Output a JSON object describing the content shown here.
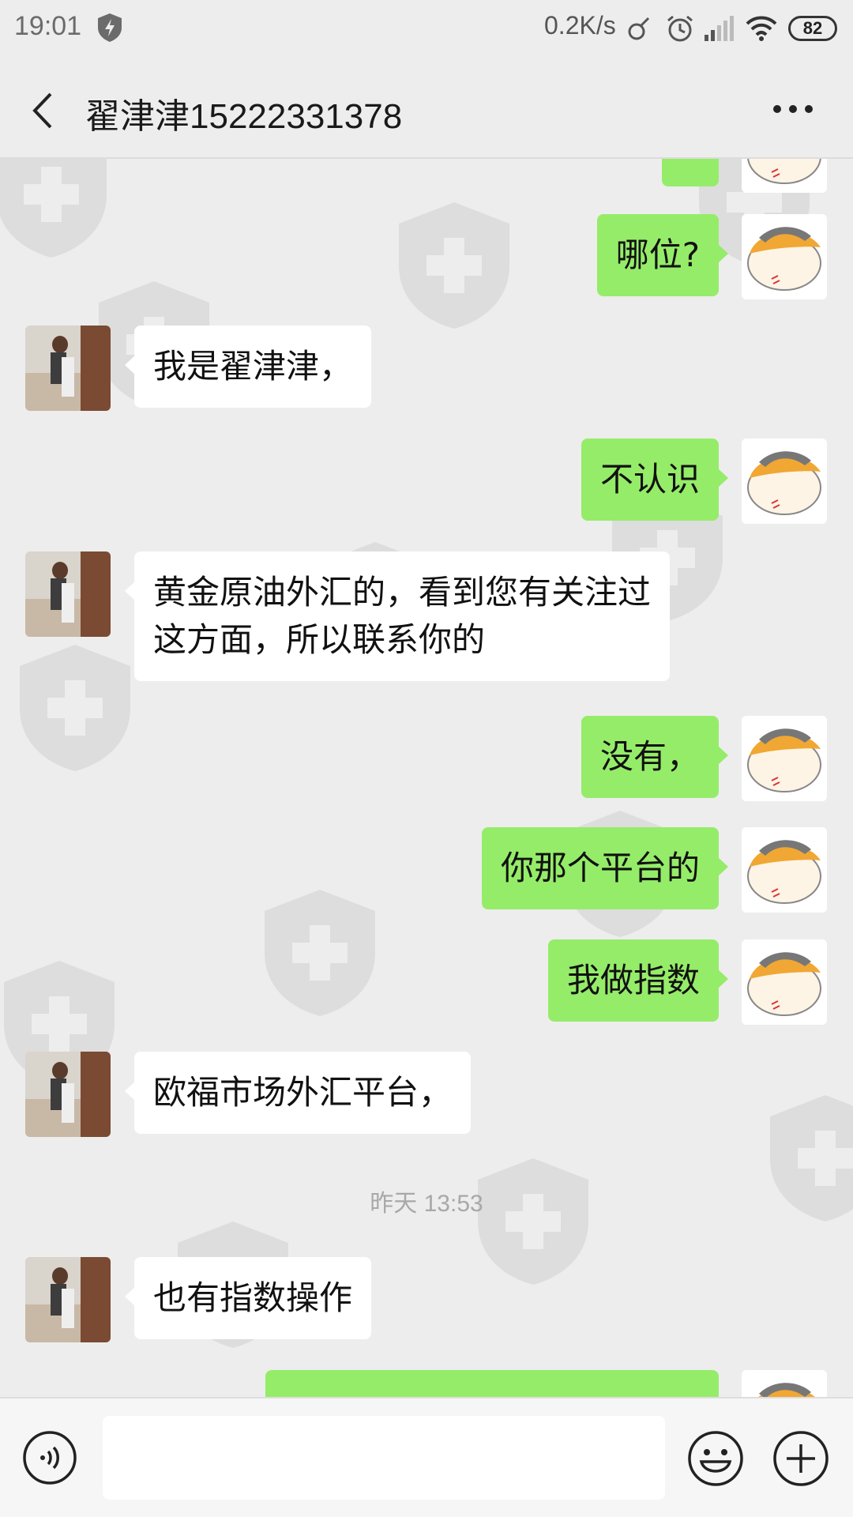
{
  "status_bar": {
    "time": "19:01",
    "net_speed": "0.2K/s",
    "battery": "82"
  },
  "header": {
    "title": "翟津津15222331378"
  },
  "messages": [
    {
      "side": "out",
      "text": ""
    },
    {
      "side": "out",
      "text": "哪位?"
    },
    {
      "side": "in",
      "text": "我是翟津津，"
    },
    {
      "side": "out",
      "text": "不认识"
    },
    {
      "side": "in",
      "text": "黄金原油外汇的，看到您有关注过\n这方面，所以联系你的"
    },
    {
      "side": "out",
      "text": "没有，"
    },
    {
      "side": "out",
      "text": "你那个平台的"
    },
    {
      "side": "out",
      "text": "我做指数"
    },
    {
      "side": "in",
      "text": "欧福市场外汇平台，"
    },
    {
      "side": "in",
      "text": "也有指数操作"
    },
    {
      "side": "out",
      "text": ""
    }
  ],
  "timestamp": "昨天 13:53",
  "input": {
    "value": "",
    "placeholder": ""
  },
  "colors": {
    "background": "#ededed",
    "outgoing_bubble": "#95ec69",
    "incoming_bubble": "#ffffff"
  },
  "icons": [
    "back-icon",
    "more-icon",
    "voice-icon",
    "emoji-icon",
    "plus-icon",
    "shield-icon",
    "wifi-icon",
    "signal-icon",
    "alarm-icon",
    "link-icon"
  ]
}
